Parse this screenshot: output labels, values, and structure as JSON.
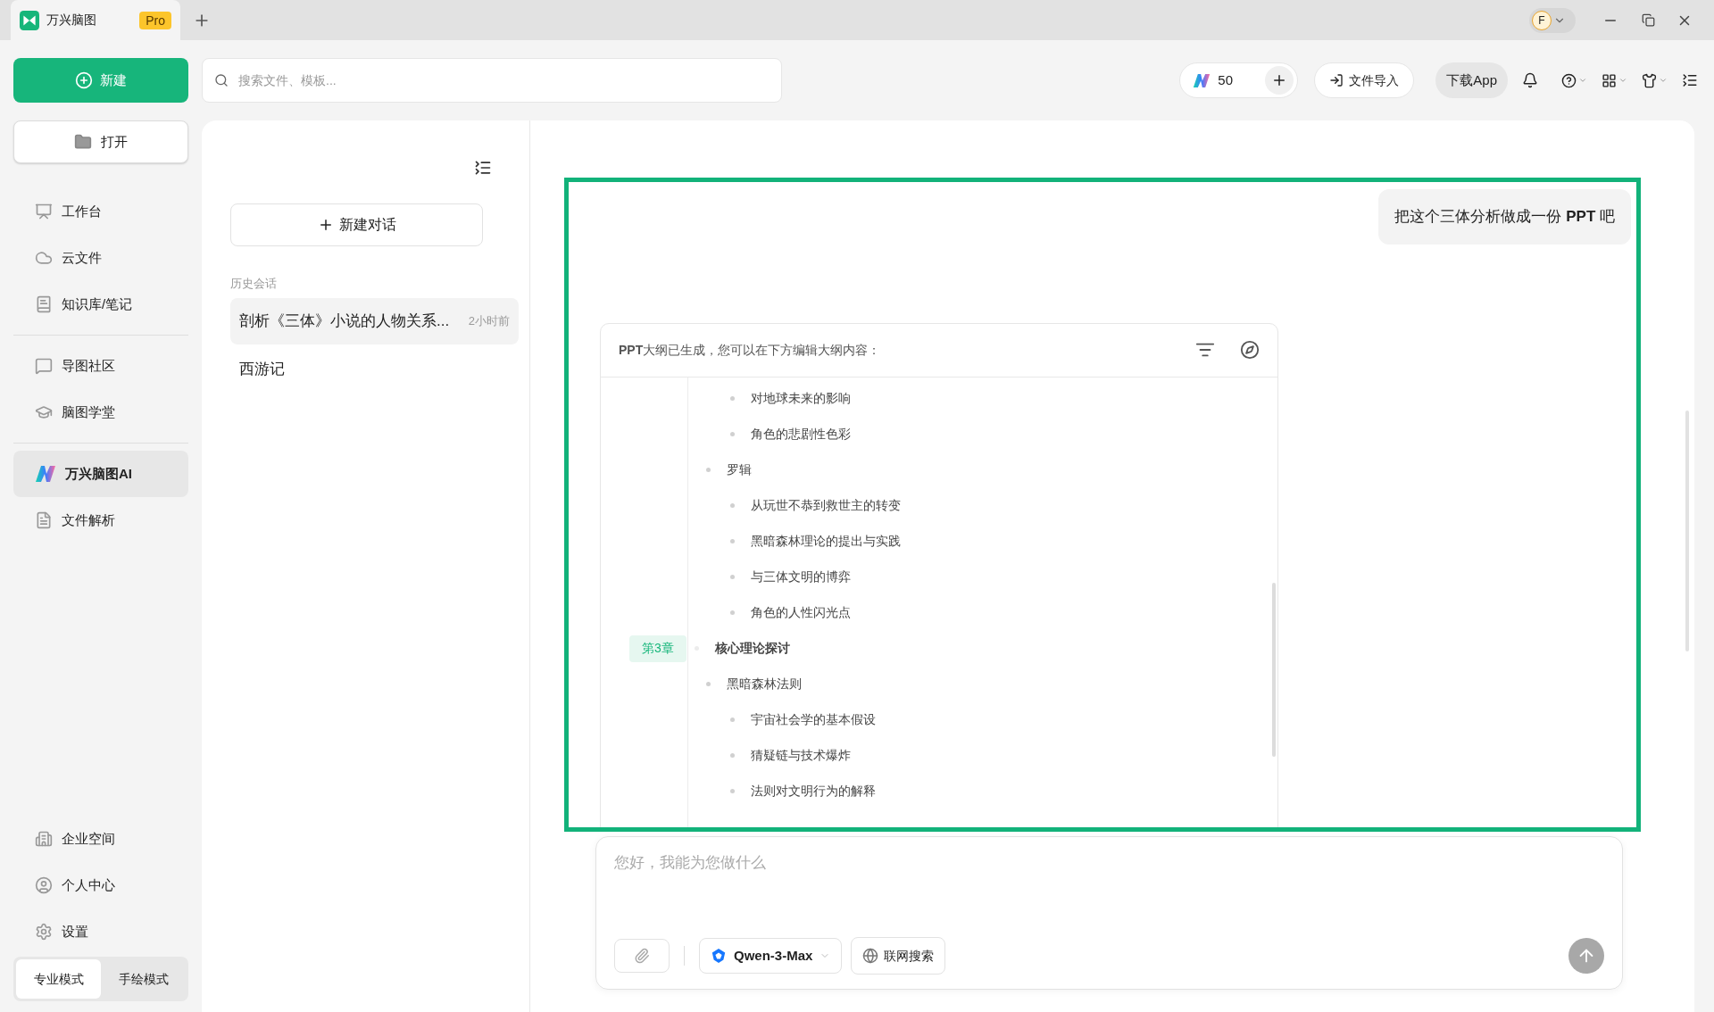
{
  "app_tab": {
    "title": "万兴脑图",
    "badge": "Pro"
  },
  "avatar": {
    "initial": "F"
  },
  "toolbar": {
    "new_button": "新建",
    "search_placeholder": "搜索文件、模板...",
    "credits": "50",
    "import_button": "文件导入",
    "download_button": "下载App"
  },
  "sidebar": {
    "open_button": "打开",
    "groups": [
      [
        {
          "label": "工作台",
          "selected": false
        },
        {
          "label": "云文件",
          "selected": false
        },
        {
          "label": "知识库/笔记",
          "selected": false
        }
      ],
      [
        {
          "label": "导图社区",
          "selected": false
        },
        {
          "label": "脑图学堂",
          "selected": false
        }
      ],
      [
        {
          "label": "万兴脑图AI",
          "selected": true
        },
        {
          "label": "文件解析",
          "selected": false
        }
      ]
    ],
    "bottom_items": [
      {
        "label": "企业空间"
      },
      {
        "label": "个人中心"
      },
      {
        "label": "设置"
      }
    ],
    "modes": [
      {
        "label": "专业模式",
        "selected": true
      },
      {
        "label": "手绘模式",
        "selected": false
      }
    ]
  },
  "history": {
    "new_chat_button": "新建对话",
    "section_label": "历史会话",
    "items": [
      {
        "title": "剖析《三体》小说的人物关系...",
        "time": "2小时前",
        "selected": true
      },
      {
        "title": "西游记",
        "selected": false
      }
    ]
  },
  "chat": {
    "user_message": "把这个三体分析做成一份 **PPT** 吧",
    "outline_card": {
      "header": "**PPT**大纲已生成，您可以在下方编辑大纲内容：",
      "items": [
        {
          "kind": "continued",
          "children": [
            {
              "kind": "continued",
              "children": [
                {
                  "kind": "point",
                  "text": "对地球未来的影响"
                },
                {
                  "kind": "point",
                  "text": "角色的悲剧性色彩"
                }
              ]
            },
            {
              "kind": "point",
              "text": "罗辑",
              "children": [
                {
                  "kind": "point",
                  "text": "从玩世不恭到救世主的转变"
                },
                {
                  "kind": "point",
                  "text": "黑暗森林理论的提出与实践"
                },
                {
                  "kind": "point",
                  "text": "与三体文明的博弈"
                },
                {
                  "kind": "point",
                  "text": "角色的人性闪光点"
                }
              ]
            }
          ]
        },
        {
          "kind": "chapter",
          "badge": "第3章",
          "text": "核心理论探讨",
          "children": [
            {
              "kind": "point",
              "text": "黑暗森林法则",
              "children": [
                {
                  "kind": "point",
                  "text": "宇宙社会学的基本假设"
                },
                {
                  "kind": "point",
                  "text": "猜疑链与技术爆炸"
                },
                {
                  "kind": "point",
                  "text": "法则对文明行为的解释"
                }
              ]
            }
          ]
        }
      ]
    }
  },
  "input": {
    "placeholder": "您好，我能为您做什么",
    "model": "Qwen-3-Max",
    "web_search": "联网搜索"
  }
}
